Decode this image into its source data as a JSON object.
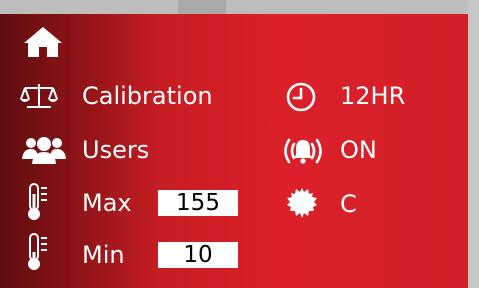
{
  "menu": {
    "calibration_label": "Calibration",
    "users_label": "Users",
    "max_label": "Max",
    "max_value": "155",
    "min_label": "Min",
    "min_value": "10",
    "clock_label": "12HR",
    "alarm_label": "ON",
    "unit_label": "C"
  },
  "icons": {
    "home": "home-icon",
    "calibration": "scale-icon",
    "users": "users-icon",
    "max": "thermometer-icon",
    "min": "thermometer-icon",
    "clock": "clock-icon",
    "alarm": "alarm-bell-icon",
    "unit": "gear-icon"
  },
  "colors": {
    "panel_dark": "#5e0d10",
    "panel_red": "#dc2029",
    "text": "#ffffff",
    "field_bg": "#ffffff"
  }
}
